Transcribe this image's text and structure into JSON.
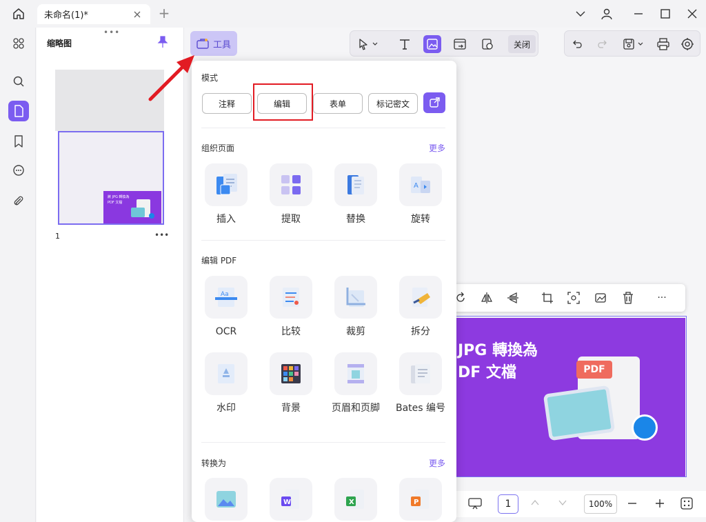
{
  "titlebar": {
    "tab_title": "未命名(1)*"
  },
  "thumbnails": {
    "panel_title": "缩略图",
    "grip": "•••",
    "page_number": "1",
    "more": "•••",
    "thumb_banner_text_1": "將 JPG 轉換為",
    "thumb_banner_text_2": "PDF 文檔"
  },
  "toolbar": {
    "tools_label": "工具",
    "close_label": "关闭"
  },
  "menu": {
    "mode_title": "模式",
    "modes": [
      "注释",
      "编辑",
      "表单",
      "标记密文"
    ],
    "organize": {
      "title": "组织页面",
      "more": "更多",
      "items": [
        "插入",
        "提取",
        "替换",
        "旋转"
      ]
    },
    "edit_pdf": {
      "title": "编辑 PDF",
      "items": [
        "OCR",
        "比较",
        "裁剪",
        "拆分",
        "水印",
        "背景",
        "页眉和页脚",
        "Bates 编号"
      ]
    },
    "convert": {
      "title": "转换为",
      "more": "更多"
    }
  },
  "document": {
    "banner_line1": "JPG 轉換為",
    "banner_line2": "DF 文檔",
    "pdf_badge": "PDF"
  },
  "bottombar": {
    "page": "1",
    "zoom": "100%"
  },
  "colors": {
    "accent": "#7b5cf0",
    "highlight": "#e21b23",
    "banner": "#8d3ae0"
  }
}
